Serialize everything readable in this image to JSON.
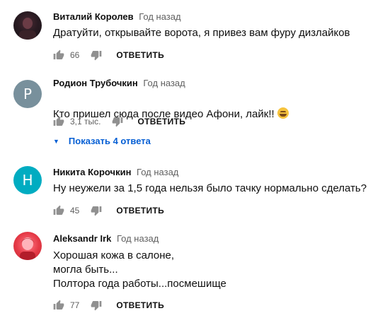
{
  "comments": [
    {
      "author": "Виталий Королев",
      "time": "Год назад",
      "avatar": {
        "type": "photo",
        "color": "#2a1b22"
      },
      "text": "Дратуйти, открывайте ворота, я привез вам фуру дизлайков",
      "likes": "66",
      "reply_label": "ОТВЕТИТЬ"
    },
    {
      "author": "Родион Трубочкин",
      "time": "Год назад",
      "avatar": {
        "type": "letter",
        "letter": "Р",
        "color": "#78909c"
      },
      "text": "Кто пришел сюда после видео Афони, лайк!!",
      "emoji": "grinning-sweat-emoji",
      "likes": "3,1 тыс.",
      "reply_label": "ОТВЕТИТЬ",
      "replies_label": "Показать 4 ответа"
    },
    {
      "author": "Никита Корочкин",
      "time": "Год назад",
      "avatar": {
        "type": "letter",
        "letter": "Н",
        "color": "#00acc1"
      },
      "text": "Ну неужели за 1,5 года нельзя было тачку нормально сделать?",
      "likes": "45",
      "reply_label": "ОТВЕТИТЬ"
    },
    {
      "author": "Aleksandr Irk",
      "time": "Год назад",
      "avatar": {
        "type": "photo",
        "color": "#e53946"
      },
      "text": "Хорошая кожа в салоне,\nмогла быть...\nПолтора года работы...посмешище",
      "likes": "77",
      "reply_label": "ОТВЕТИТЬ"
    }
  ],
  "colors": {
    "link": "#065fd4",
    "secondary_text": "#606060",
    "primary_text": "#0f0f0f"
  },
  "icons": {
    "like": "thumbs-up-icon",
    "dislike": "thumbs-down-icon",
    "expand": "caret-down-icon"
  }
}
